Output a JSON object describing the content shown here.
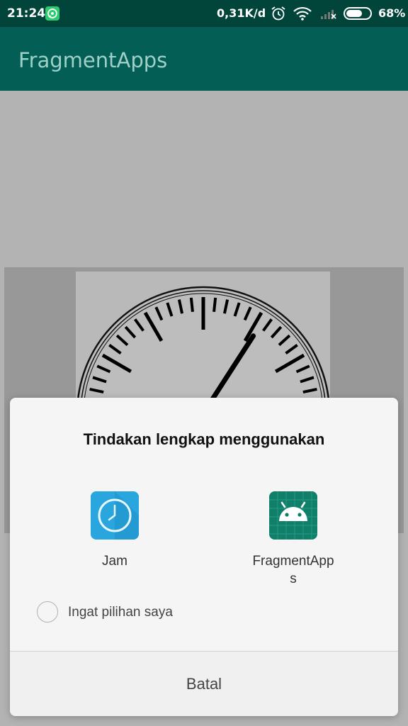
{
  "status_bar": {
    "time": "21:24",
    "net_speed": "0,31K/d",
    "battery_percent": "68%",
    "battery_level": 0.68,
    "icons": [
      "whatsapp-icon",
      "alarm-clock-icon",
      "wifi-icon",
      "signal-no-service-icon",
      "battery-icon"
    ]
  },
  "app_bar": {
    "title": "FragmentApps"
  },
  "dialog": {
    "title": "Tindakan lengkap menggunakan",
    "apps": [
      {
        "label": "Jam",
        "icon": "clock-app-icon",
        "color": "#29a8e0"
      },
      {
        "label": "FragmentApps",
        "icon": "android-app-icon",
        "color": "#0f7f6a"
      }
    ],
    "remember_label": "Ingat pilihan saya",
    "remember_checked": false,
    "cancel_label": "Batal"
  },
  "colors": {
    "status_bar": "#00443a",
    "app_bar": "#035e55",
    "title_text": "#9ed0c8",
    "scrim_background": "#b3b3b3"
  }
}
